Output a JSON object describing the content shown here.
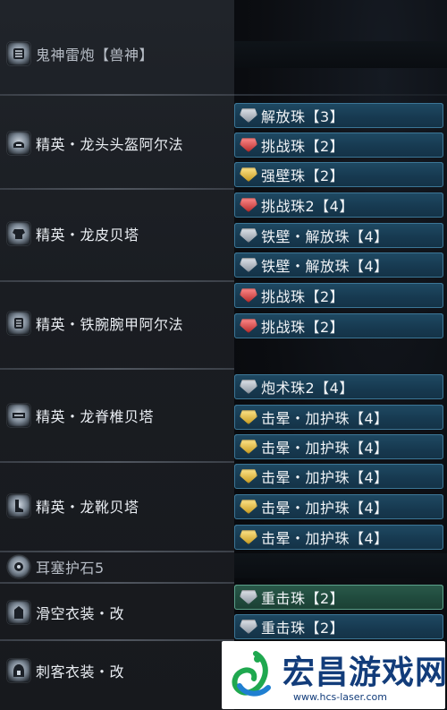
{
  "armor_rows": [
    {
      "label": "鬼神雷炮【兽神】",
      "icon": "weapon-icon"
    },
    {
      "label": "精英・龙头头盔阿尔法",
      "icon": "helmet-icon"
    },
    {
      "label": "精英・龙皮贝塔",
      "icon": "chest-icon"
    },
    {
      "label": "精英・铁腕腕甲阿尔法",
      "icon": "arm-icon"
    },
    {
      "label": "精英・龙脊椎贝塔",
      "icon": "waist-icon"
    },
    {
      "label": "精英・龙靴贝塔",
      "icon": "leg-icon"
    },
    {
      "label": "耳塞护石5",
      "icon": "charm-icon"
    },
    {
      "label": "滑空衣装・改",
      "icon": "mantle-icon"
    },
    {
      "label": "刺客衣装・改",
      "icon": "hood-icon"
    }
  ],
  "jewels": [
    {
      "text": "解放珠【3】",
      "color": "gray"
    },
    {
      "text": "挑战珠【2】",
      "color": "red"
    },
    {
      "text": "强壁珠【2】",
      "color": "yellow"
    },
    {
      "text": "挑战珠2【4】",
      "color": "red"
    },
    {
      "text": "铁壁・解放珠【4】",
      "color": "gray"
    },
    {
      "text": "铁壁・解放珠【4】",
      "color": "gray"
    },
    {
      "text": "挑战珠【2】",
      "color": "red"
    },
    {
      "text": "挑战珠【2】",
      "color": "red"
    },
    {
      "text": "炮术珠2【4】",
      "color": "gray"
    },
    {
      "text": "击晕・加护珠【4】",
      "color": "yellow"
    },
    {
      "text": "击晕・加护珠【4】",
      "color": "yellow"
    },
    {
      "text": "击晕・加护珠【4】",
      "color": "yellow"
    },
    {
      "text": "击晕・加护珠【4】",
      "color": "yellow"
    },
    {
      "text": "击晕・加护珠【4】",
      "color": "yellow"
    },
    {
      "text": "重击珠【2】",
      "color": "gray",
      "selected": true
    },
    {
      "text": "重击珠【2】",
      "color": "gray"
    }
  ],
  "watermark": {
    "title": "宏昌游戏网",
    "url": "www.hcs-laser.com"
  }
}
